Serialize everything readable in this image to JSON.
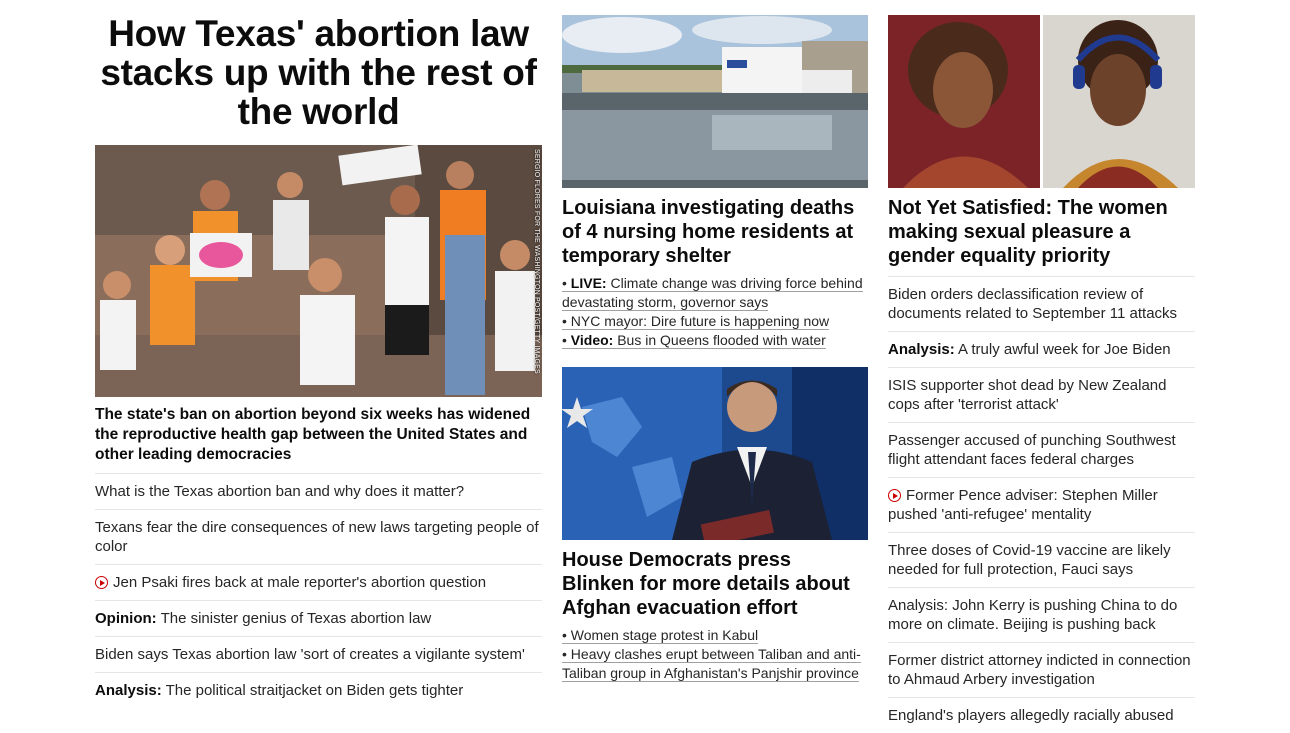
{
  "col1": {
    "title": "How Texas' abortion law stacks up with the rest of the world",
    "photo_credit": "SERGIO FLORES FOR THE WASHINGTON POST/GETTY IMAGES",
    "description": "The state's ban on abortion beyond six weeks has widened the reproductive health gap between the United States and other leading democracies",
    "stories": [
      {
        "prefix": "",
        "text": "What is the Texas abortion ban and why does it matter?"
      },
      {
        "prefix": "",
        "text": "Texans fear the dire consequences of new laws targeting people of color"
      },
      {
        "prefix": "",
        "text": "Jen Psaki fires back at male reporter's abortion question"
      },
      {
        "prefix": "Opinion:",
        "text": "The sinister genius of Texas abortion law"
      },
      {
        "prefix": "",
        "text": "Biden says Texas abortion law 'sort of creates a vigilante system'"
      },
      {
        "prefix": "Analysis:",
        "text": "The political straitjacket on Biden gets tighter"
      }
    ]
  },
  "col2": {
    "story1": {
      "headline": "Louisiana investigating deaths of 4 nursing home residents at temporary shelter",
      "bullets": [
        {
          "prefix": "LIVE:",
          "text": "Climate change was driving force behind devastating storm, governor says"
        },
        {
          "prefix": "",
          "text": "NYC mayor: Dire future is happening now"
        },
        {
          "prefix": "Video:",
          "text": "Bus in Queens flooded with water"
        }
      ]
    },
    "story2": {
      "headline": "House Democrats press Blinken for more details about Afghan evacuation effort",
      "bullets": [
        {
          "prefix": "",
          "text": "Women stage protest in Kabul"
        },
        {
          "prefix": "",
          "text": "Heavy clashes erupt between Taliban and anti-Taliban group in Afghanistan's Panjshir province"
        }
      ]
    }
  },
  "col3": {
    "headline": "Not Yet Satisfied: The women making sexual pleasure a gender equality priority",
    "stories": [
      {
        "prefix": "",
        "text": "Biden orders declassification review of documents related to September 11 attacks"
      },
      {
        "prefix": "Analysis:",
        "text": "A truly awful week for Joe Biden"
      },
      {
        "prefix": "",
        "text": "ISIS supporter shot dead by New Zealand cops after 'terrorist attack'"
      },
      {
        "prefix": "",
        "text": "Passenger accused of punching Southwest flight attendant faces federal charges"
      },
      {
        "prefix": "",
        "text": "Former Pence adviser: Stephen Miller pushed 'anti-refugee' mentality"
      },
      {
        "prefix": "",
        "text": "Three doses of Covid-19 vaccine are likely needed for full protection, Fauci says"
      },
      {
        "prefix": "",
        "text": "Analysis: John Kerry is pushing China to do more on climate. Beijing is pushing back"
      },
      {
        "prefix": "",
        "text": "Former district attorney indicted in connection to Ahmaud Arbery investigation"
      },
      {
        "prefix": "",
        "text": "England's players allegedly racially abused"
      }
    ]
  },
  "colors": {
    "accent_red": "#cc0000",
    "text": "#0c0c0c",
    "divider": "#e6e6e6"
  }
}
